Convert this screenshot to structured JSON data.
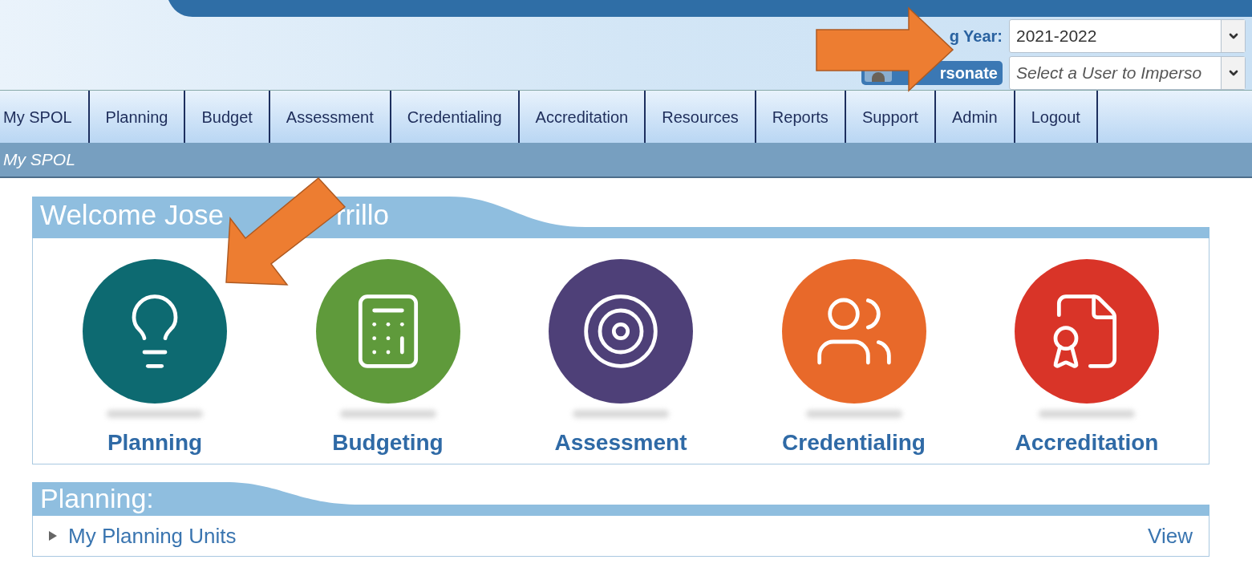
{
  "header": {
    "year_label": "g Year:",
    "year_value": "2021-2022",
    "impersonate_button": "rsonate",
    "impersonate_placeholder": "Select a User to Imperso"
  },
  "nav": [
    {
      "label": "My SPOL"
    },
    {
      "label": "Planning"
    },
    {
      "label": "Budget"
    },
    {
      "label": "Assessment"
    },
    {
      "label": "Credentialing"
    },
    {
      "label": "Accreditation"
    },
    {
      "label": "Resources"
    },
    {
      "label": "Reports"
    },
    {
      "label": "Support"
    },
    {
      "label": "Admin"
    },
    {
      "label": "Logout"
    }
  ],
  "breadcrumb": "My SPOL",
  "welcome": {
    "title_parts": [
      "Welcome Jose",
      "rrillo"
    ],
    "modules": [
      {
        "kind": "bulb",
        "label": "Planning",
        "color": "#0d6a71"
      },
      {
        "kind": "calculator",
        "label": "Budgeting",
        "color": "#5f9a3b"
      },
      {
        "kind": "target",
        "label": "Assessment",
        "color": "#4e4078"
      },
      {
        "kind": "people",
        "label": "Credentialing",
        "color": "#e8692a"
      },
      {
        "kind": "certificate",
        "label": "Accreditation",
        "color": "#d93428"
      }
    ]
  },
  "planning": {
    "title": "Planning:",
    "rows": [
      {
        "label": "My Planning Units",
        "action": "View",
        "expanded": false
      }
    ]
  }
}
